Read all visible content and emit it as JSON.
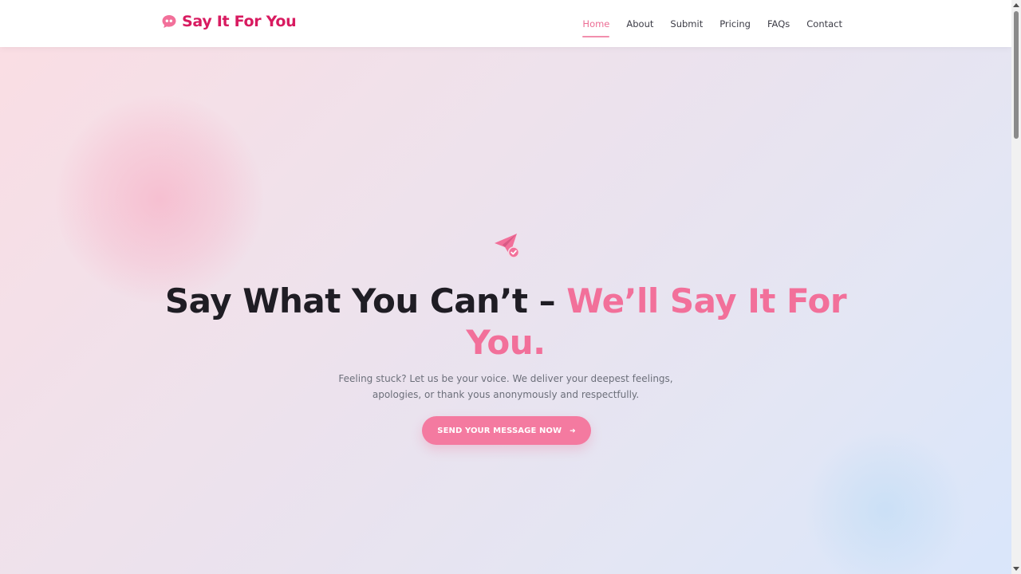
{
  "brand": {
    "name": "Say It For You",
    "icon": "quote-bubble-icon",
    "color": "#d81b60"
  },
  "nav": {
    "items": [
      {
        "label": "Home",
        "active": true
      },
      {
        "label": "About",
        "active": false
      },
      {
        "label": "Submit",
        "active": false
      },
      {
        "label": "Pricing",
        "active": false
      },
      {
        "label": "FAQs",
        "active": false
      },
      {
        "label": "Contact",
        "active": false
      }
    ],
    "active_color": "#ec6d94"
  },
  "hero": {
    "icon": "paper-plane-check-icon",
    "title_main": "Say What You Can’t – ",
    "title_accent": "We’ll Say It For You.",
    "subtitle_line1": "Feeling stuck? Let us be your voice. We deliver your deepest feelings,",
    "subtitle_line2": "apologies, or thank yous anonymously and respectfully.",
    "cta_label": "SEND YOUR MESSAGE NOW",
    "cta_icon": "arrow-right-icon",
    "accent_color": "#f2709a"
  }
}
